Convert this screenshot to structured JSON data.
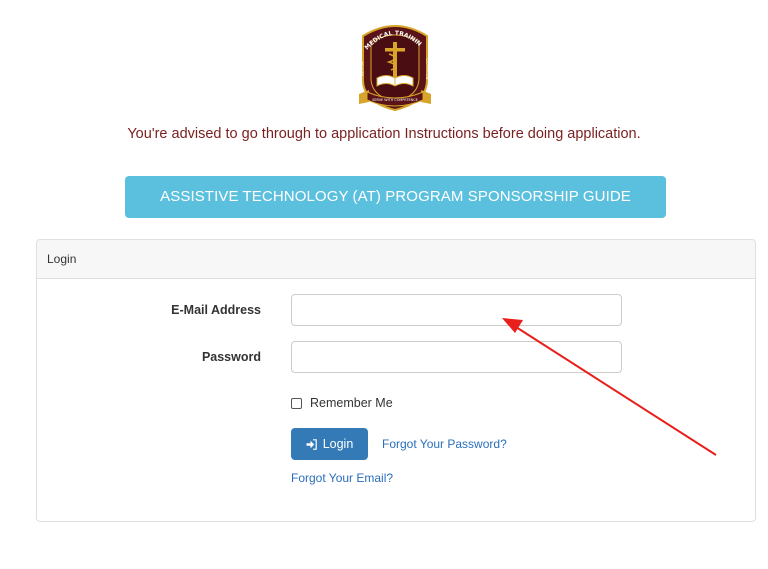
{
  "logo": {
    "text_top": "MEDICAL TRAINING",
    "text_left": "KENYA",
    "text_right": "COLLEGE",
    "motto": "SERVE WITH COMPETENCE",
    "colors": {
      "shield": "#5a1418",
      "gold": "#d8a52a"
    }
  },
  "notice": {
    "text": "You're advised to go through to application Instructions before doing application."
  },
  "guide_button": {
    "label": "ASSISTIVE TECHNOLOGY (AT) PROGRAM SPONSORSHIP GUIDE"
  },
  "login_card": {
    "header": "Login",
    "email": {
      "label": "E-Mail Address",
      "value": "",
      "placeholder": ""
    },
    "password": {
      "label": "Password",
      "value": "",
      "placeholder": ""
    },
    "remember": {
      "label": "Remember Me",
      "checked": false
    },
    "login_button": {
      "label": "Login",
      "icon": "sign-in-icon"
    },
    "forgot_password": "Forgot Your Password?",
    "forgot_email": "Forgot Your Email?"
  },
  "annotation": {
    "type": "arrow",
    "color": "#e8201c"
  },
  "colors": {
    "notice_text": "#7a1f1f",
    "info_button": "#5bc0de",
    "primary_button": "#337ab7",
    "link": "#2a6ebb"
  }
}
